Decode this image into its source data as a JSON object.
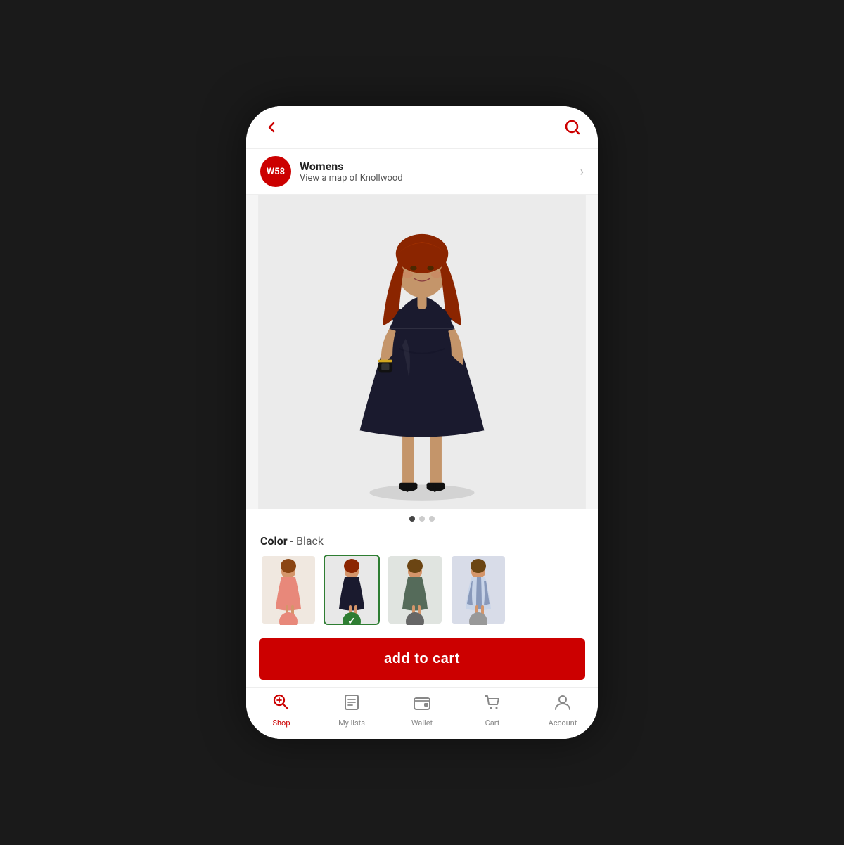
{
  "header": {
    "back_label": "←",
    "search_label": "🔍"
  },
  "store": {
    "badge": "W58",
    "name": "Womens",
    "subtitle": "View a map of Knollwood",
    "chevron": "›"
  },
  "product": {
    "color_label": "Color",
    "color_name": "Black",
    "image_alt": "Woman in navy dress"
  },
  "dots": [
    {
      "active": true
    },
    {
      "active": false
    },
    {
      "active": false
    }
  ],
  "swatches": [
    {
      "label": "Coral/Salmon dress",
      "color": "salmon",
      "selected": false
    },
    {
      "label": "Navy/Black dress",
      "color": "navy",
      "selected": true
    },
    {
      "label": "Olive dress",
      "color": "olive",
      "selected": false
    },
    {
      "label": "Striped dress",
      "color": "stripe",
      "selected": false
    }
  ],
  "cart": {
    "button_label": "add to cart"
  },
  "bottom_nav": {
    "items": [
      {
        "id": "shop",
        "label": "Shop",
        "active": true
      },
      {
        "id": "my-lists",
        "label": "My lists",
        "active": false
      },
      {
        "id": "wallet",
        "label": "Wallet",
        "active": false
      },
      {
        "id": "cart",
        "label": "Cart",
        "active": false
      },
      {
        "id": "account",
        "label": "Account",
        "active": false
      }
    ]
  }
}
